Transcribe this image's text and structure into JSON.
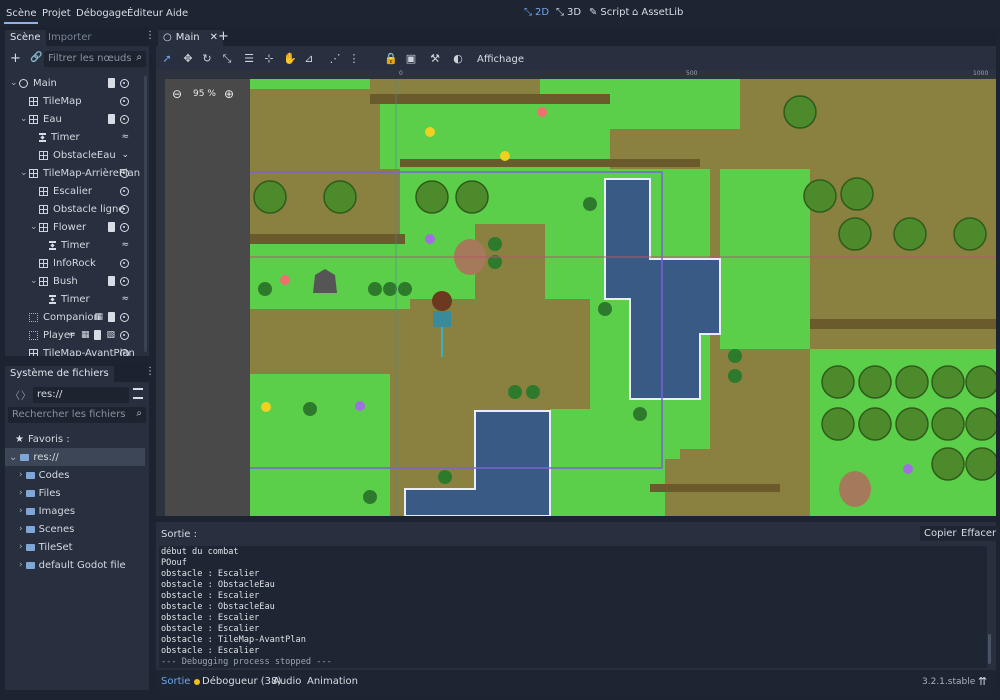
{
  "menu": [
    "Scène",
    "Projet",
    "Débogage",
    "Éditeur",
    "Aide"
  ],
  "workspaces": [
    "2D",
    "3D",
    "Script",
    "AssetLib"
  ],
  "scene_dock": {
    "tabs": [
      "Scène",
      "Importer"
    ],
    "filter_placeholder": "Filtrer les nœuds",
    "nodes": [
      {
        "label": "Main",
        "depth": 0,
        "kind": "node",
        "arrow": "v",
        "icons": [
          "script",
          "eye"
        ]
      },
      {
        "label": "TileMap",
        "depth": 1,
        "kind": "grid",
        "arrow": "",
        "icons": [
          "eye"
        ]
      },
      {
        "label": "Eau",
        "depth": 1,
        "kind": "grid",
        "arrow": "v",
        "icons": [
          "script",
          "eye"
        ]
      },
      {
        "label": "Timer",
        "depth": 2,
        "kind": "timer",
        "arrow": "",
        "icons": [
          "signal"
        ]
      },
      {
        "label": "ObstacleEau",
        "depth": 2,
        "kind": "grid",
        "arrow": "",
        "icons": [
          "fold"
        ]
      },
      {
        "label": "TileMap-ArrièrePlan",
        "depth": 1,
        "kind": "grid",
        "arrow": "v",
        "icons": [
          "eye"
        ]
      },
      {
        "label": "Escalier",
        "depth": 2,
        "kind": "grid",
        "arrow": "",
        "icons": [
          "eye"
        ]
      },
      {
        "label": "Obstacle ligne",
        "depth": 2,
        "kind": "grid",
        "arrow": "",
        "icons": [
          "eye"
        ]
      },
      {
        "label": "Flower",
        "depth": 2,
        "kind": "grid",
        "arrow": "v",
        "icons": [
          "script",
          "eye"
        ]
      },
      {
        "label": "Timer",
        "depth": 3,
        "kind": "timer",
        "arrow": "",
        "icons": [
          "signal"
        ]
      },
      {
        "label": "InfoRock",
        "depth": 2,
        "kind": "grid",
        "arrow": "",
        "icons": [
          "eye"
        ]
      },
      {
        "label": "Bush",
        "depth": 2,
        "kind": "grid",
        "arrow": "v",
        "icons": [
          "script",
          "eye"
        ]
      },
      {
        "label": "Timer",
        "depth": 3,
        "kind": "timer",
        "arrow": "",
        "icons": [
          "signal"
        ]
      },
      {
        "label": "Companion",
        "depth": 1,
        "kind": "kin",
        "arrow": "",
        "icons": [
          "film",
          "script",
          "eye"
        ]
      },
      {
        "label": "Player",
        "depth": 1,
        "kind": "kin",
        "arrow": "",
        "icons": [
          "signal",
          "film",
          "script",
          "group",
          "eye"
        ]
      },
      {
        "label": "TileMap-AvantPlan",
        "depth": 1,
        "kind": "grid",
        "arrow": "",
        "icons": [
          "eye"
        ]
      }
    ]
  },
  "filesystem": {
    "title": "Système de fichiers",
    "path": "res://",
    "search_placeholder": "Rechercher les fichiers",
    "favorites_label": "Favoris :",
    "root": "res://",
    "folders": [
      "Codes",
      "Files",
      "Images",
      "Scenes",
      "TileSet",
      "default Godot file"
    ]
  },
  "editor": {
    "scene_tab": "Main",
    "view_menu": "Affichage",
    "zoom": "95 %",
    "ruler_marks": [
      "0",
      "500",
      "1000"
    ]
  },
  "output": {
    "title": "Sortie :",
    "copy_label": "Copier",
    "clear_label": "Effacer",
    "lines": [
      "début du combat",
      "POouf",
      "obstacle : Escalier",
      "obstacle : ObstacleEau",
      "obstacle : Escalier",
      "obstacle : ObstacleEau",
      "obstacle : Escalier",
      "obstacle : Escalier",
      "obstacle : TileMap-AvantPlan",
      "obstacle : Escalier",
      "--- Debugging process stopped ---"
    ]
  },
  "bottom_tabs": [
    "Sortie",
    "Débogueur (38)",
    "Audio",
    "Animation"
  ],
  "version": "3.2.1.stable",
  "colors": {
    "accent": "#6fa5ee",
    "grass": "#5ccf4a",
    "dirt": "#8a8040",
    "water": "#3a5a86",
    "selection": "#7a63d6"
  }
}
